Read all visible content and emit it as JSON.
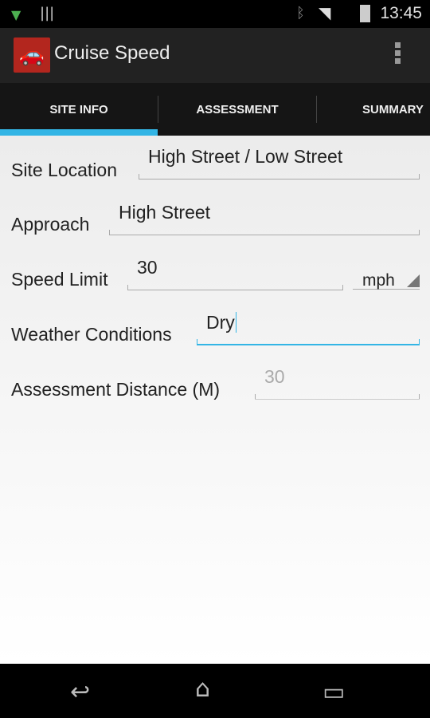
{
  "status": {
    "time": "13:45"
  },
  "app": {
    "title": "Cruise Speed"
  },
  "tabs": [
    {
      "label": "SITE INFO",
      "selected": true
    },
    {
      "label": "ASSESSMENT"
    },
    {
      "label": "SUMMARY"
    }
  ],
  "form": {
    "site_location": {
      "label": "Site Location",
      "value": "High Street / Low Street"
    },
    "approach": {
      "label": "Approach",
      "value": "High Street"
    },
    "speed_limit": {
      "label": "Speed Limit",
      "value": "30",
      "unit": "mph"
    },
    "weather": {
      "label": "Weather Conditions",
      "value": "Dry"
    },
    "distance": {
      "label": "Assessment Distance (M)",
      "placeholder": "30"
    }
  },
  "colors": {
    "accent": "#33b5e5",
    "app_icon": "#b3261e"
  }
}
